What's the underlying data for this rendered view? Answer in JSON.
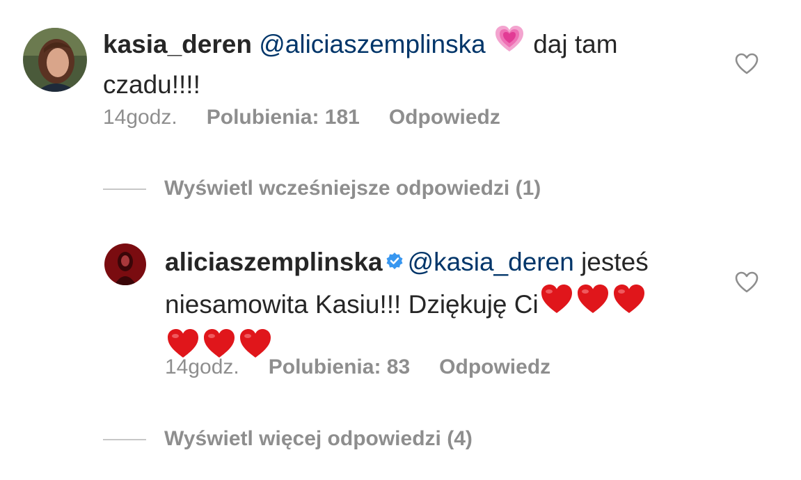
{
  "comments": [
    {
      "username": "kasia_deren",
      "mention": "@aliciaszemplinska",
      "text_after_emoji": "daj tam",
      "text_line2": "czadu!!!!",
      "emoji": "growing-heart-emoji",
      "time": "14godz.",
      "likes": "Polubienia: 181",
      "reply": "Odpowiedz"
    },
    {
      "username": "aliciaszemplinska",
      "verified": true,
      "mention": "@kasia_deren",
      "text_line1_after": "jesteś",
      "text_line2": "niesamowita Kasiu!!! Dziękuję Ci",
      "emoji": "red-heart-emoji",
      "time": "14godz.",
      "likes": "Polubienia: 83",
      "reply": "Odpowiedz"
    }
  ],
  "view_earlier_replies": "Wyświetl wcześniejsze odpowiedzi (1)",
  "view_more_replies": "Wyświetl więcej odpowiedzi (4)",
  "colors": {
    "text": "#262626",
    "mention": "#003569",
    "meta": "#8e8e8e",
    "verified": "#3897f0",
    "red_heart": "#e0161b",
    "pink_heart": "#f06bb5"
  }
}
